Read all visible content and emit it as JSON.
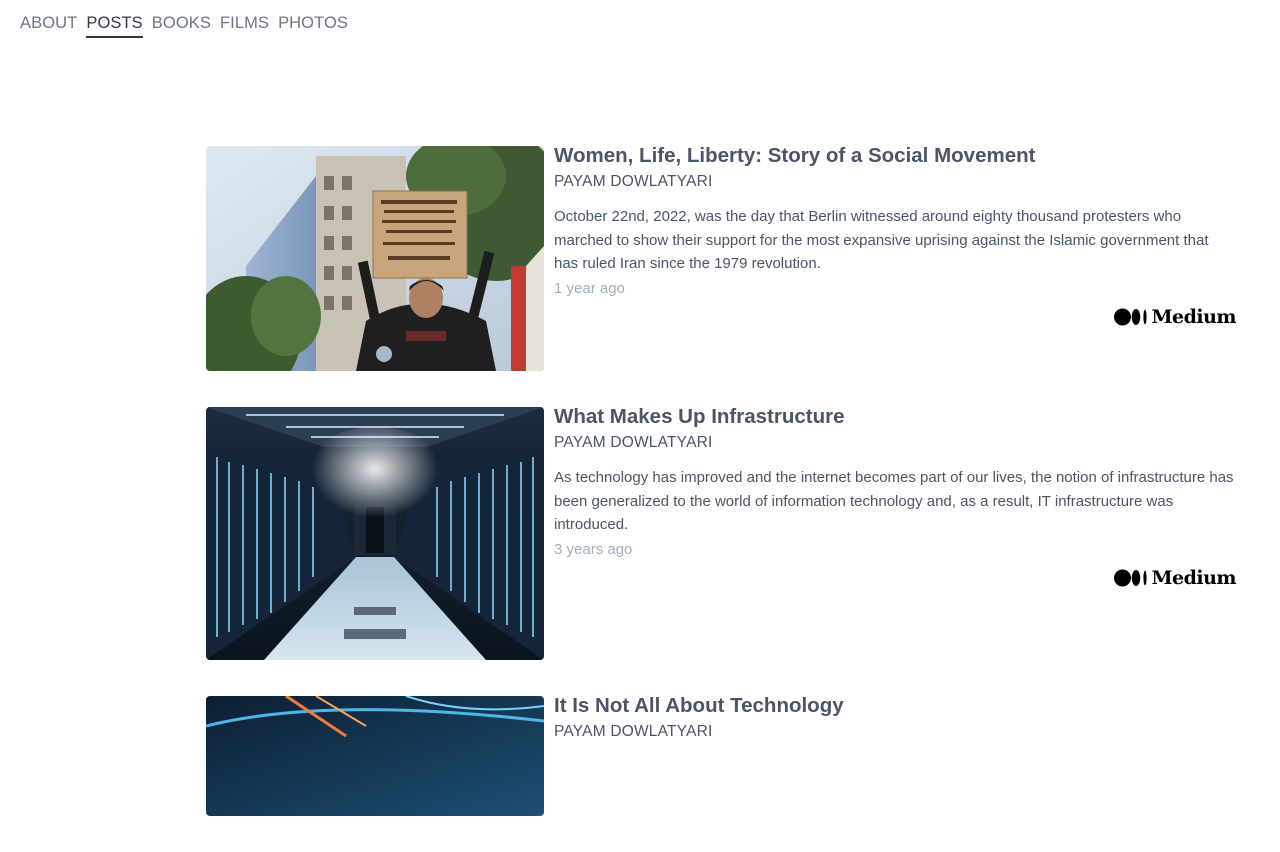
{
  "nav": {
    "items": [
      {
        "label": "ABOUT"
      },
      {
        "label": "POSTS"
      },
      {
        "label": "BOOKS"
      },
      {
        "label": "FILMS"
      },
      {
        "label": "PHOTOS"
      }
    ],
    "active": "POSTS"
  },
  "posts": [
    {
      "title": "Women, Life, Liberty: Story of a Social Movement",
      "author": "PAYAM DOWLATYARI",
      "excerpt": "October 22nd, 2022, was the day that Berlin witnessed around eighty thousand protesters who marched to show their support for the most expansive uprising against the Islamic government that has ruled Iran since the 1979 revolution.",
      "date": "1 year ago",
      "source": "Medium",
      "image_icon": "protest-photo"
    },
    {
      "title": "What Makes Up Infrastructure",
      "author": "PAYAM DOWLATYARI",
      "excerpt": "As technology has improved and the internet becomes part of our lives, the notion of infrastructure has been generalized to the world of information technology and, as a result, IT infrastructure was introduced.",
      "date": "3 years ago",
      "source": "Medium",
      "image_icon": "datacenter-photo"
    },
    {
      "title": "It Is Not All About Technology",
      "author": "PAYAM DOWLATYARI",
      "image_icon": "tech-light-photo"
    }
  ],
  "colors": {
    "text": "#4a5568",
    "muted": "#a0aec0",
    "nav": "#6b7588",
    "nav_active": "#2d3748"
  }
}
